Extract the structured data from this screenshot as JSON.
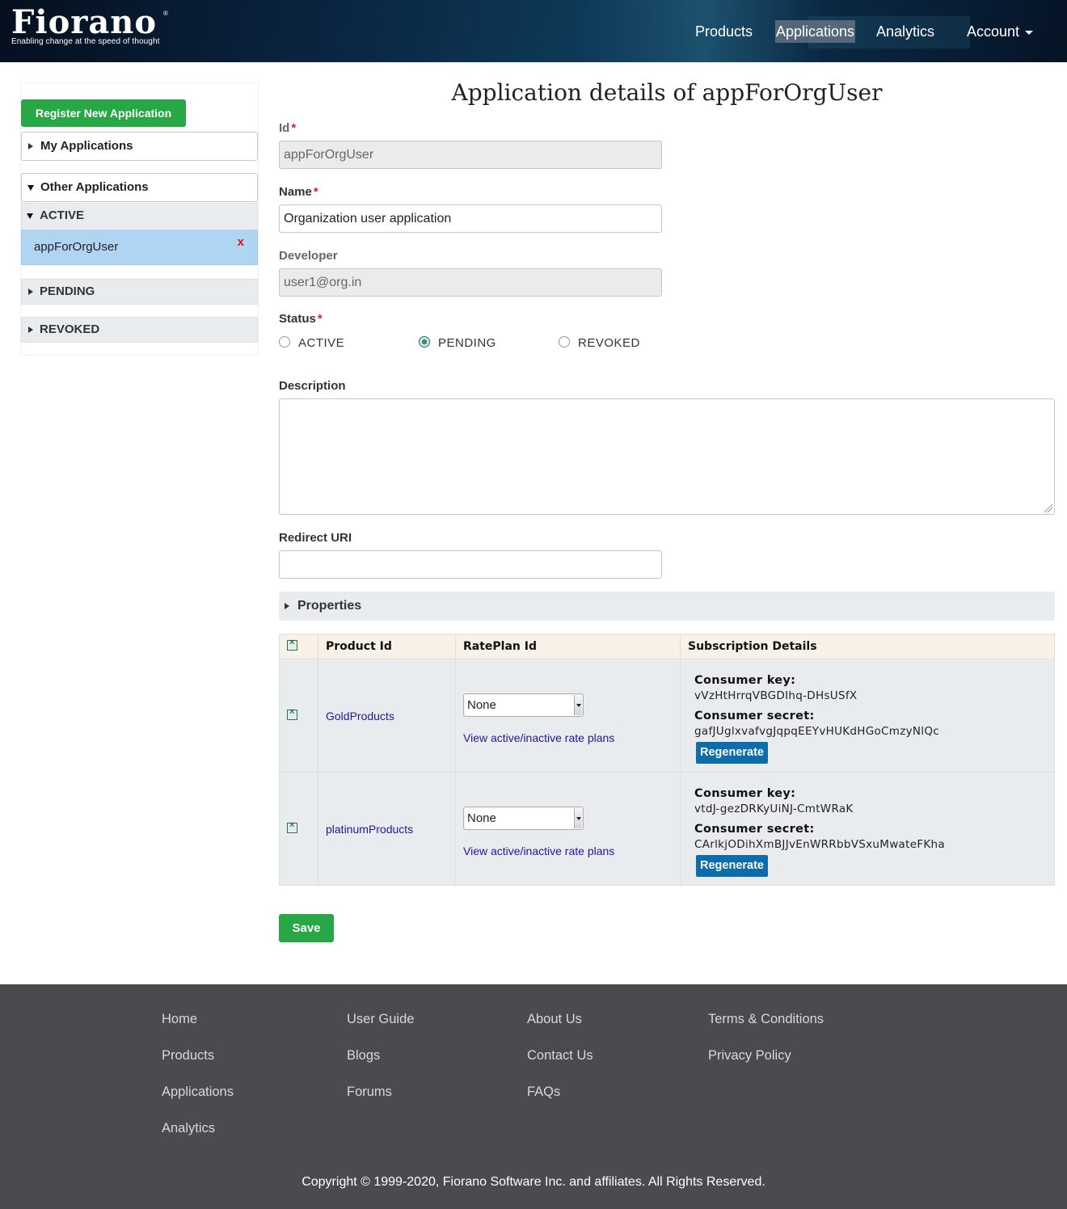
{
  "header": {
    "logo_text": "Fiorano",
    "logo_tagline": "Enabling change at the speed of thought",
    "nav": {
      "products": "Products",
      "applications": "Applications",
      "analytics": "Analytics",
      "account": "Account"
    }
  },
  "sidebar": {
    "register_button": "Register New Application",
    "my_applications": "My Applications",
    "other_applications": "Other Applications",
    "sections": {
      "active": "ACTIVE",
      "pending": "PENDING",
      "revoked": "REVOKED"
    },
    "active_app": "appForOrgUser",
    "delete_mark": "x"
  },
  "main": {
    "title": "Application details of appForOrgUser",
    "id_label": "Id",
    "id_value": "appForOrgUser",
    "name_label": "Name",
    "name_value": "Organization user application",
    "developer_label": "Developer",
    "developer_value": "user1@org.in",
    "status_label": "Status",
    "status_options": [
      "ACTIVE",
      "PENDING",
      "REVOKED"
    ],
    "status_selected": "PENDING",
    "required_mark": "*",
    "description_label": "Description",
    "description_value": "",
    "redirect_label": "Redirect URI",
    "redirect_value": "",
    "properties_label": "Properties",
    "save_button": "Save"
  },
  "table": {
    "headers": [
      "",
      "Product Id",
      "RatePlan Id",
      "Subscription Details"
    ],
    "rows": [
      {
        "product": "GoldProducts",
        "rateplan": "None",
        "rate_link": "View active/inactive rate plans",
        "key_label": "Consumer key:",
        "key": "vVzHtHrrqVBGDIhq-DHsUSfX",
        "secret_label": "Consumer secret:",
        "secret": "gafJUglxvafvgJqpqEEYvHUKdHGoCmzyNlQc",
        "regen": "Regenerate"
      },
      {
        "product": "platinumProducts",
        "rateplan": "None",
        "rate_link": "View active/inactive rate plans",
        "key_label": "Consumer key:",
        "key": "vtdJ-gezDRKyUiNJ-CmtWRaK",
        "secret_label": "Consumer secret:",
        "secret": "CArlkjODihXmBJJvEnWRRbbVSxuMwateFKha",
        "regen": "Regenerate"
      }
    ]
  },
  "footer": {
    "col1": [
      "Home",
      "Products",
      "Applications",
      "Analytics"
    ],
    "col2": [
      "User Guide",
      "Blogs",
      "Forums"
    ],
    "col3": [
      "About Us",
      "Contact Us",
      "FAQs"
    ],
    "col4": [
      "Terms & Conditions",
      "Privacy Policy"
    ],
    "copyright": "Copyright © 1999-2020, Fiorano Software Inc. and affiliates. All Rights Reserved."
  },
  "colors": {
    "accent_green": "#28a745",
    "button_blue": "#0d6daa",
    "footer_bg": "#4a4b4e",
    "selected_app": "#b0d5f2"
  }
}
